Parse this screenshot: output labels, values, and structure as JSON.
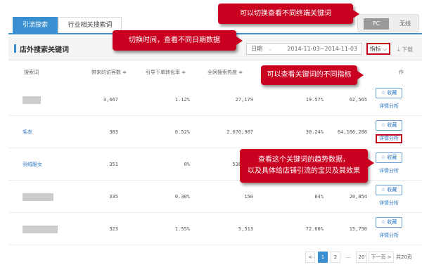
{
  "tabs": [
    {
      "label": "引流搜索词",
      "active": true
    },
    {
      "label": "行业相关搜索词",
      "active": false
    }
  ],
  "device_toggle": {
    "pc": "PC",
    "wireless": "无线"
  },
  "section": {
    "title": "店外搜索关键词",
    "date_label": "日期",
    "date_range": "2014-11-03~2014-11-03",
    "metric_button": "指标",
    "download": "下载"
  },
  "table": {
    "columns": [
      "搜索词",
      "带来的访客数 ≑",
      "引导下单转化率 ≑",
      "全网搜索热度 ≑",
      "作"
    ],
    "rows": [
      {
        "keyword": "",
        "visits": "3,667",
        "conversion": "1.12%",
        "heat": "27,179",
        "col4": "19.57%",
        "col5": "62,565"
      },
      {
        "keyword": "毛衣",
        "visits": "383",
        "conversion": "0.52%",
        "heat": "2,076,907",
        "col4": "30.24%",
        "col5": "64,166,288"
      },
      {
        "keyword": "羽绒服女",
        "visits": "351",
        "conversion": "0%",
        "heat": "538,154",
        "col4": "",
        "col5": ""
      },
      {
        "keyword": "",
        "visits": "335",
        "conversion": "0.30%",
        "heat": "150",
        "col4": "84%",
        "col5": "20,854"
      },
      {
        "keyword": "",
        "visits": "323",
        "conversion": "1.55%",
        "heat": "5,513",
        "col4": "72.66%",
        "col5": "15,750"
      }
    ],
    "fav_label": "☆ 收藏",
    "detail_label": "详情分析"
  },
  "pager": {
    "prev": "<",
    "pages": [
      "1",
      "2",
      "…",
      "20"
    ],
    "next": "下一页 >",
    "total": "共20页"
  },
  "callouts": {
    "toggle": "可以切换查看不同终端关键词",
    "date": "切换时间，查看不同日期数据",
    "metric": "可以查看关键词的不同指标",
    "detail_line1": "查看这个关键词的趋势数据，",
    "detail_line2": "以及具体给店铺引流的宝贝及其效果"
  },
  "colors": {
    "accent": "#3a8fd1",
    "callout": "#c9001f",
    "link": "#2a75c2"
  }
}
